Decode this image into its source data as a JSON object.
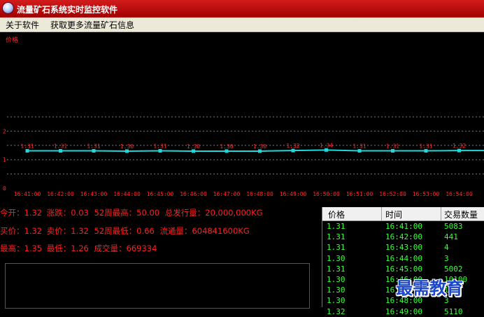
{
  "window": {
    "title": "流量矿石系统实时监控软件",
    "icon": "app-globe-icon"
  },
  "menu": {
    "items": [
      "关于软件",
      "获取更多流量矿石信息"
    ]
  },
  "chart_data": {
    "type": "line",
    "ylabel": "价格",
    "ylim": [
      0,
      2.5
    ],
    "yticks": [
      "0",
      "1",
      "2"
    ],
    "x": [
      "16:41:00",
      "16:42:00",
      "16:43:00",
      "16:44:00",
      "16:45:00",
      "16:46:00",
      "16:47:00",
      "16:48:00",
      "16:49:00",
      "16:50:00",
      "16:51:00",
      "16:52:00",
      "16:53:00",
      "16:54:00"
    ],
    "values": [
      1.31,
      1.31,
      1.31,
      1.3,
      1.31,
      1.3,
      1.3,
      1.3,
      1.32,
      1.34,
      1.31,
      1.31,
      1.31,
      1.32
    ],
    "point_labels": [
      "1.31",
      "1.31",
      "1.31",
      "1.30",
      "1.31",
      "1.30",
      "1.30",
      "1.30",
      "1.32",
      "1.34",
      "1.31",
      "1.31",
      "1.31",
      "1.32"
    ],
    "grid": "horizontal dashed",
    "colors": {
      "line": "#20d8d8",
      "label": "#ff2a2a",
      "tick": "#ff2a2a",
      "grid": "#7a7a7a"
    }
  },
  "stats": {
    "row1": [
      "今开：1.32",
      "涨跌：0.03",
      "52周最高：50.00",
      "总发行量：20,000,000KG"
    ],
    "row2": [
      "买价：1.32",
      "卖价：1.32",
      "52周最低：0.66",
      "流通量：604841600KG"
    ],
    "row3": [
      "最高：1.35",
      "最低：1.26",
      "成交量：669334"
    ]
  },
  "trades": {
    "headers": [
      "价格",
      "时间",
      "交易数量"
    ],
    "rows": [
      [
        "1.31",
        "16:41:00",
        "5083"
      ],
      [
        "1.31",
        "16:42:00",
        "441"
      ],
      [
        "1.31",
        "16:43:00",
        "4"
      ],
      [
        "1.30",
        "16:44:00",
        "3"
      ],
      [
        "1.31",
        "16:45:00",
        "5002"
      ],
      [
        "1.30",
        "16:46:00",
        "10100"
      ],
      [
        "1.30",
        "16:47:00",
        "15"
      ],
      [
        "1.30",
        "16:48:00",
        "3"
      ],
      [
        "1.32",
        "16:49:00",
        "5110"
      ]
    ]
  },
  "watermark": "最需教育"
}
